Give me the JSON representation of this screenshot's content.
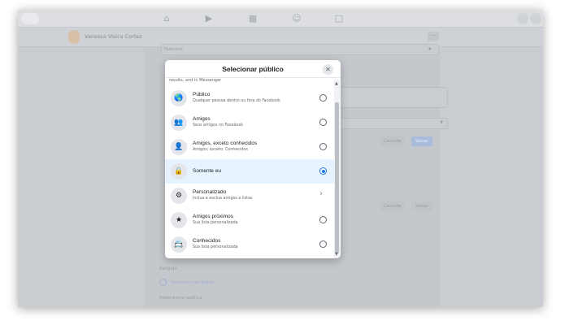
{
  "nav": {
    "icons": [
      "home-icon",
      "watch-icon",
      "marketplace-icon",
      "groups-icon",
      "gaming-icon"
    ],
    "right_icons": [
      "menu-grid-icon",
      "notifications-icon"
    ]
  },
  "profile": {
    "name": "Vanessa Vieira Cortez",
    "more_label": "···"
  },
  "background": {
    "field_value": "Feminino",
    "cancel_label": "Cancelar",
    "save_label": "Salvar",
    "religion_heading": "Religião",
    "add_religion_link": "Adicionar sua religião",
    "political_heading": "Preferência política"
  },
  "modal": {
    "title": "Selecionar público",
    "close_glyph": "✕",
    "clipped_text": "results, and in Messenger",
    "options": [
      {
        "title": "Público",
        "subtitle": "Qualquer pessoa dentro ou fora do Facebook",
        "icon": "globe-icon",
        "glyph": "🌎",
        "control": "radio",
        "selected": false
      },
      {
        "title": "Amigos",
        "subtitle": "Seus amigos no Facebook",
        "icon": "friends-icon",
        "glyph": "👥",
        "control": "radio",
        "selected": false
      },
      {
        "title": "Amigos, exceto conhecidos",
        "subtitle": "Amigos; exceto: Conhecidos",
        "icon": "friends-except-icon",
        "glyph": "👤",
        "control": "radio",
        "selected": false
      },
      {
        "title": "Somente eu",
        "subtitle": "",
        "icon": "lock-icon",
        "glyph": "🔒",
        "control": "radio",
        "selected": true
      },
      {
        "title": "Personalizado",
        "subtitle": "Inclua e exclua amigos e listas",
        "icon": "gear-icon",
        "glyph": "⚙",
        "control": "chevron",
        "selected": false
      },
      {
        "title": "Amigos próximos",
        "subtitle": "Sua lista personalizada",
        "icon": "star-icon",
        "glyph": "★",
        "control": "radio",
        "selected": false
      },
      {
        "title": "Conhecidos",
        "subtitle": "Sua lista personalizada",
        "icon": "acquaintances-icon",
        "glyph": "📇",
        "control": "radio",
        "selected": false
      }
    ]
  },
  "colors": {
    "accent": "#1877f2",
    "selected_bg": "#e7f3ff"
  }
}
